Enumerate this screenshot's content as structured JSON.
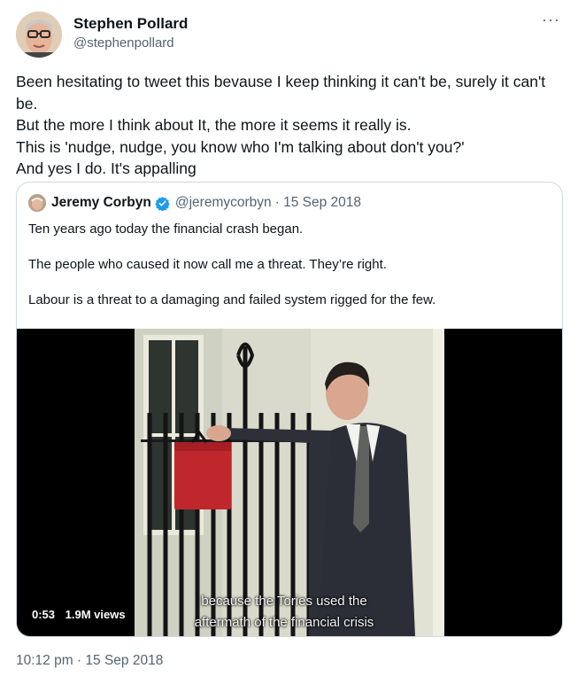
{
  "tweet": {
    "author_name": "Stephen Pollard",
    "author_handle": "@stephenpollard",
    "more_label": "···",
    "text": "Been hesitating to tweet this bevause I keep thinking it can't be, surely it can't be.\nBut the more I think about It, the more it seems it really is.\nThis is 'nudge, nudge, you know who I'm talking about don't you?'\nAnd yes I do. It's appalling",
    "timestamp": "10:12 pm · 15 Sep 2018"
  },
  "quoted_tweet": {
    "author_name": "Jeremy Corbyn",
    "author_handle": "@jeremycorbyn",
    "date": "· 15 Sep 2018",
    "verified": true,
    "text": "Ten years ago today the financial crash began.\n\nThe people who caused it now call me a threat. They’re right.\n\nLabour is a threat to a damaging and failed system rigged for the few.",
    "video": {
      "duration": "0:53",
      "views": "1.9M views",
      "caption_line1": "because the Tories used the",
      "caption_line2": "aftermath of the financial crisis"
    }
  },
  "colors": {
    "text": "#0f1419",
    "secondary": "#536471",
    "border": "#cfd9de",
    "verified": "#1d9bf0",
    "budget_box": "#c0272d"
  }
}
